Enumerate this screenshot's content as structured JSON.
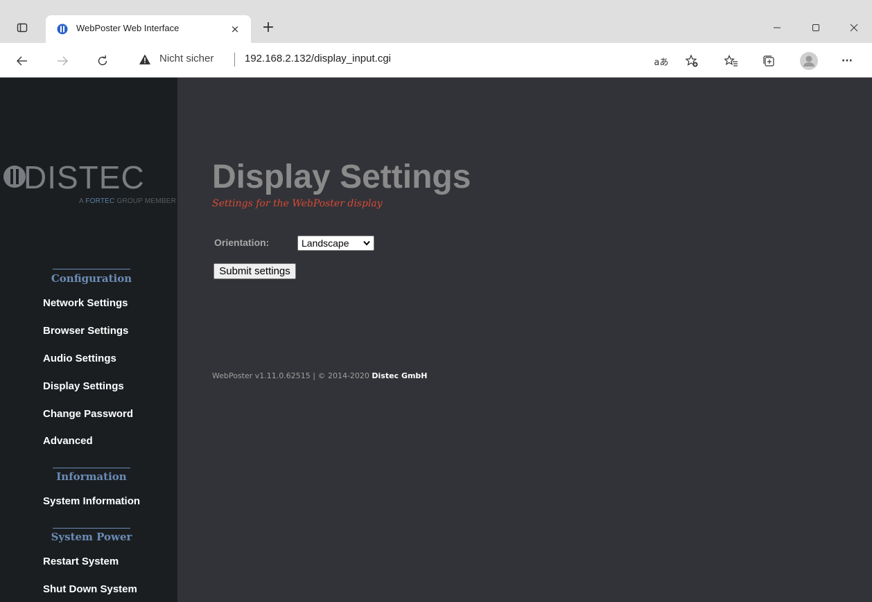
{
  "browser": {
    "tab_title": "WebPoster Web Interface",
    "tab_close": "×",
    "new_tab": "+",
    "security_label": "Nicht sicher",
    "url": "192.168.2.132/display_input.cgi",
    "read_aloud_icon": "aあ",
    "more_icon": "···"
  },
  "sidebar": {
    "logo_word": "DISTEC",
    "logo_tag_prefix": "A ",
    "logo_tag_accent": "FORTEC",
    "logo_tag_suffix": " GROUP MEMBER",
    "sections": [
      {
        "title": "Configuration",
        "items": [
          "Network Settings",
          "Browser Settings",
          "Audio Settings",
          "Display Settings",
          "Change Password",
          "Advanced"
        ]
      },
      {
        "title": "Information",
        "items": [
          "System Information"
        ]
      },
      {
        "title": "System Power",
        "items": [
          "Restart System",
          "Shut Down System"
        ]
      }
    ]
  },
  "main": {
    "title": "Display Settings",
    "subtitle": "Settings for the WebPoster display",
    "orientation_label": "Orientation:",
    "orientation_value": "Landscape",
    "submit_label": "Submit settings",
    "footer_prefix": "WebPoster v1.11.0.62515 | © 2014-2020 ",
    "footer_company": "Distec GmbH"
  },
  "colors": {
    "page_bg": "#323338",
    "sidebar_bg": "#1a1e21",
    "section_title": "#6c8cb6",
    "subtitle": "#d94a35"
  }
}
